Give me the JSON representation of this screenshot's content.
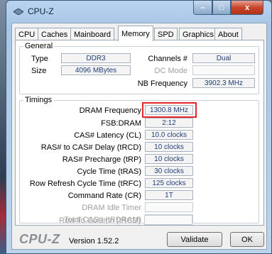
{
  "window": {
    "title": "CPU-Z"
  },
  "controls": {
    "minimize": "–",
    "maximize": "□",
    "close": "x"
  },
  "tabs": [
    {
      "label": "CPU",
      "active": false
    },
    {
      "label": "Caches",
      "active": false
    },
    {
      "label": "Mainboard",
      "active": false
    },
    {
      "label": "Memory",
      "active": true
    },
    {
      "label": "SPD",
      "active": false
    },
    {
      "label": "Graphics",
      "active": false
    },
    {
      "label": "About",
      "active": false
    }
  ],
  "general": {
    "legend": "General",
    "type_label": "Type",
    "type_value": "DDR3",
    "size_label": "Size",
    "size_value": "4096 MBytes",
    "channels_label": "Channels #",
    "channels_value": "Dual",
    "dc_mode_label": "DC Mode",
    "dc_mode_value": "",
    "nb_freq_label": "NB Frequency",
    "nb_freq_value": "3902.3 MHz"
  },
  "timings": {
    "legend": "Timings",
    "rows": [
      {
        "label": "DRAM Frequency",
        "value": "1300.8 MHz",
        "enabled": true
      },
      {
        "label": "FSB:DRAM",
        "value": "2:12",
        "enabled": true
      },
      {
        "label": "CAS# Latency (CL)",
        "value": "10.0 clocks",
        "enabled": true
      },
      {
        "label": "RAS# to CAS# Delay (tRCD)",
        "value": "10 clocks",
        "enabled": true
      },
      {
        "label": "RAS# Precharge (tRP)",
        "value": "10 clocks",
        "enabled": true
      },
      {
        "label": "Cycle Time (tRAS)",
        "value": "30 clocks",
        "enabled": true
      },
      {
        "label": "Row Refresh Cycle Time (tRFC)",
        "value": "125 clocks",
        "enabled": true
      },
      {
        "label": "Command Rate (CR)",
        "value": "1T",
        "enabled": true
      },
      {
        "label": "DRAM Idle Timer",
        "value": "",
        "enabled": false
      },
      {
        "label": "Total CAS# (tRDRAM)",
        "value": "",
        "enabled": false
      },
      {
        "label": "Row To Column (tRCD)",
        "value": "",
        "enabled": false
      }
    ]
  },
  "footer": {
    "logo": "CPU-Z",
    "version": "Version 1.52.2",
    "validate_label": "Validate",
    "ok_label": "OK"
  },
  "colors": {
    "highlight": "#e8262a",
    "value_text": "#1f3d7a"
  }
}
